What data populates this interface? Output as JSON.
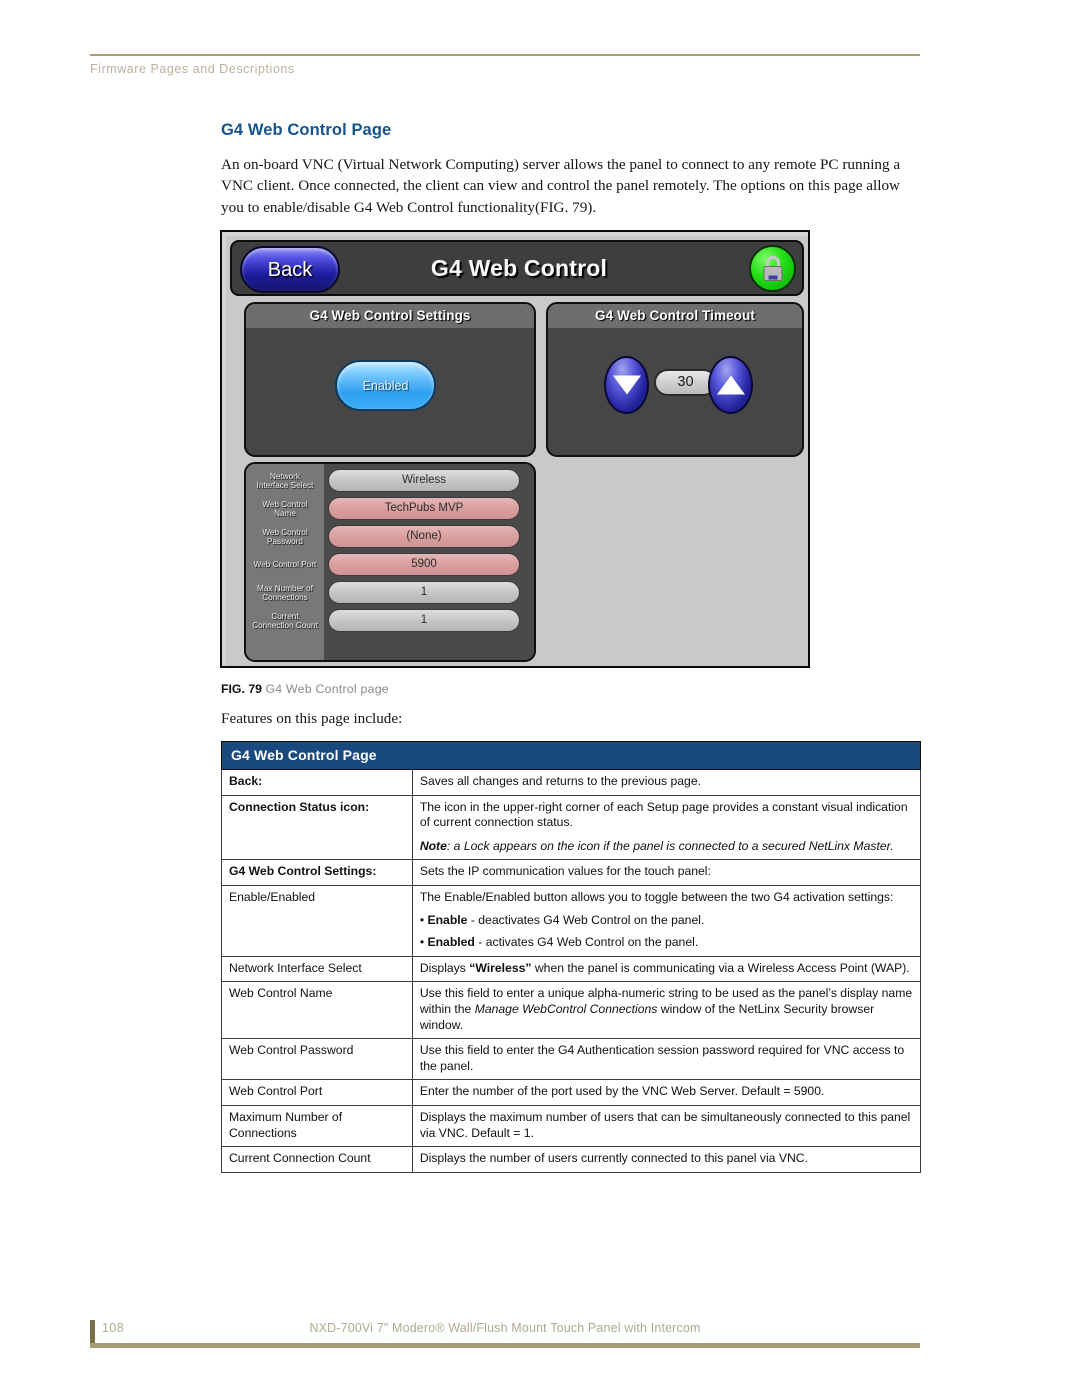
{
  "running_header": "Firmware Pages and Descriptions",
  "section_title": "G4 Web Control Page",
  "intro_paragraph": "An on-board VNC (Virtual Network Computing) server allows the panel to connect to any remote PC running a VNC client. Once connected, the client can view and control the panel remotely. The options on this page allow you to enable/disable G4 Web Control functionality(FIG. 79).",
  "figure": {
    "caption_label": "FIG. 79",
    "caption_text": "G4 Web Control page",
    "panel": {
      "back_button": "Back",
      "title": "G4 Web Control",
      "status_icon": "lock-icon",
      "settings_box": {
        "header": "G4 Web Control Settings",
        "toggle_button": "Enabled"
      },
      "timeout_box": {
        "header": "G4 Web Control Timeout",
        "value": "30",
        "decrement_icon": "triangle-down-icon",
        "increment_icon": "triangle-up-icon"
      },
      "fields": [
        {
          "label": "Network\nInterface Select",
          "value": "Wireless",
          "style": "grey"
        },
        {
          "label": "Web Control\nName",
          "value": "TechPubs MVP",
          "style": "pink"
        },
        {
          "label": "Web Control\nPassword",
          "value": "(None)",
          "style": "pink"
        },
        {
          "label": "Web Control Port",
          "value": "5900",
          "style": "pink"
        },
        {
          "label": "Max Number of\nConnections",
          "value": "1",
          "style": "grey"
        },
        {
          "label": "Current\nConnection Count",
          "value": "1",
          "style": "grey"
        }
      ]
    }
  },
  "features_intro": "Features on this page include:",
  "table": {
    "title": "G4 Web Control Page",
    "rows": [
      {
        "term": "Back:",
        "term_bold": true,
        "desc_lines": [
          "Saves all changes and returns to the previous page."
        ]
      },
      {
        "term": "Connection Status icon:",
        "term_bold": true,
        "desc_lines": [
          "The icon in the upper-right corner of each Setup page provides a constant visual indication of current connection status."
        ],
        "note_prefix": "Note",
        "note_text": ": a Lock appears on the icon if the panel is connected to a secured NetLinx Master."
      },
      {
        "term": "G4 Web Control Settings:",
        "term_bold": true,
        "desc_lines": [
          "Sets the IP communication values for the touch panel:"
        ]
      },
      {
        "term": "Enable/Enabled",
        "term_bold": false,
        "indent": true,
        "desc_lines": [
          "The Enable/Enabled button allows you to toggle between the two G4 activation settings:"
        ],
        "bullets": [
          {
            "bold": "Enable",
            "rest": " - deactivates G4 Web Control on the panel."
          },
          {
            "bold": "Enabled",
            "rest": " - activates G4 Web Control on the panel."
          }
        ]
      },
      {
        "term": "Network Interface Select",
        "term_bold": false,
        "indent": true,
        "rich": "wireless",
        "desc_lines": [
          "Displays “Wireless” when the panel is communicating via a Wireless Access Point (WAP)."
        ]
      },
      {
        "term": "Web Control Name",
        "term_bold": false,
        "indent": true,
        "rich": "manage",
        "desc_lines": [
          "Use this field to enter a unique alpha-numeric string to be used as the panel’s display name within the Manage WebControl Connections window of the NetLinx Security browser window."
        ]
      },
      {
        "term": "Web Control Password",
        "term_bold": false,
        "indent": true,
        "desc_lines": [
          "Use this field to enter the G4 Authentication session password required for VNC access to the panel."
        ]
      },
      {
        "term": "Web Control Port",
        "term_bold": false,
        "indent": true,
        "desc_lines": [
          "Enter the number of the port used by the VNC Web Server. Default = 5900."
        ]
      },
      {
        "term": "Maximum Number of Connections",
        "term_bold": false,
        "indent": true,
        "desc_lines": [
          "Displays the maximum number of users that can be simultaneously connected to this panel via VNC. Default = 1."
        ]
      },
      {
        "term": "Current Connection Count",
        "term_bold": false,
        "indent": true,
        "desc_lines": [
          "Displays the number of users currently connected to this panel via VNC."
        ]
      }
    ]
  },
  "footer": {
    "page_number": "108",
    "document_title": "NXD-700Vi 7\" Modero® Wall/Flush Mount Touch Panel with Intercom"
  },
  "colors": {
    "heading_blue": "#16538c",
    "table_header_blue": "#184a80",
    "rule_tan": "#a89d72",
    "status_green": "#24e018"
  }
}
